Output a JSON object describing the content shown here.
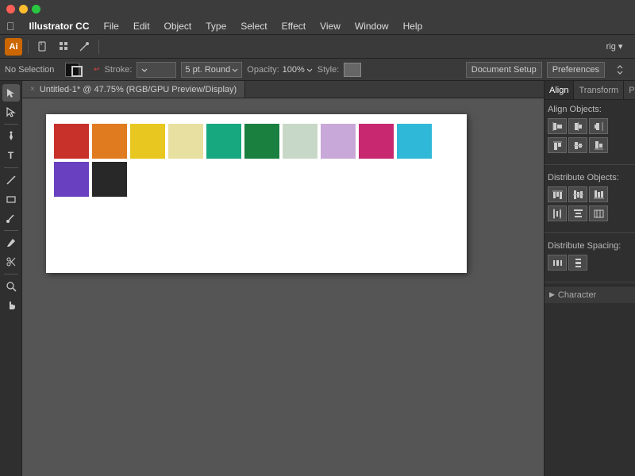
{
  "titleBar": {
    "trafficLights": [
      "close",
      "minimize",
      "maximize"
    ]
  },
  "menuBar": {
    "appName": "Illustrator CC",
    "items": [
      {
        "label": "File"
      },
      {
        "label": "Edit"
      },
      {
        "label": "Object"
      },
      {
        "label": "Type"
      },
      {
        "label": "Select"
      },
      {
        "label": "Effect"
      },
      {
        "label": "View"
      },
      {
        "label": "Window"
      },
      {
        "label": "Help"
      }
    ]
  },
  "toolbar": {
    "rightLabel": "rig ▾"
  },
  "optionsBar": {
    "noSelection": "No Selection",
    "strokeLabel": "Stroke:",
    "ptLabel": "5 pt. Round",
    "opacityLabel": "Opacity:",
    "opacityValue": "100%",
    "styleLabel": "Style:",
    "docSetupBtn": "Document Setup",
    "preferencesBtn": "Preferences"
  },
  "docTab": {
    "closeBtn": "×",
    "title": "Untitled-1* @ 47.75% (RGB/GPU Preview/Display)"
  },
  "swatches": [
    {
      "color": "#c8302a",
      "name": "Red"
    },
    {
      "color": "#e07b20",
      "name": "Orange"
    },
    {
      "color": "#e8c820",
      "name": "Yellow"
    },
    {
      "color": "#e8e0a0",
      "name": "Light Yellow"
    },
    {
      "color": "#18a880",
      "name": "Teal"
    },
    {
      "color": "#1a8040",
      "name": "Green"
    },
    {
      "color": "#c8d8c8",
      "name": "Light Gray-Green"
    },
    {
      "color": "#c8a8d8",
      "name": "Light Purple"
    },
    {
      "color": "#c82870",
      "name": "Pink"
    },
    {
      "color": "#30b8d8",
      "name": "Cyan"
    },
    {
      "color": "#6840c0",
      "name": "Purple"
    },
    {
      "color": "#282828",
      "name": "Black"
    }
  ],
  "rightPanel": {
    "tabs": [
      {
        "label": "Align",
        "active": true
      },
      {
        "label": "Transform"
      },
      {
        "label": "Pat"
      }
    ],
    "alignObjects": {
      "title": "Align Objects:",
      "buttons": [
        {
          "icon": "⬛",
          "name": "align-left"
        },
        {
          "icon": "⬛",
          "name": "align-center-h"
        },
        {
          "icon": "⬛",
          "name": "align-right"
        }
      ]
    },
    "distributeObjects": {
      "title": "Distribute Objects:",
      "buttons": [
        {
          "icon": "⬛",
          "name": "dist-top"
        },
        {
          "icon": "⬛",
          "name": "dist-center-v"
        },
        {
          "icon": "⬛",
          "name": "dist-bottom"
        }
      ]
    },
    "distributeSpacing": {
      "title": "Distribute Spacing:",
      "buttons": [
        {
          "icon": "⬛",
          "name": "dist-space-h"
        },
        {
          "icon": "⬛",
          "name": "dist-space-v"
        }
      ]
    },
    "characterPanel": {
      "label": "Character"
    }
  },
  "tools": [
    "arrow",
    "direct-select",
    "pen",
    "curvature",
    "type",
    "line",
    "shape",
    "paint",
    "eyedropper",
    "scissors",
    "zoom",
    "hand"
  ]
}
